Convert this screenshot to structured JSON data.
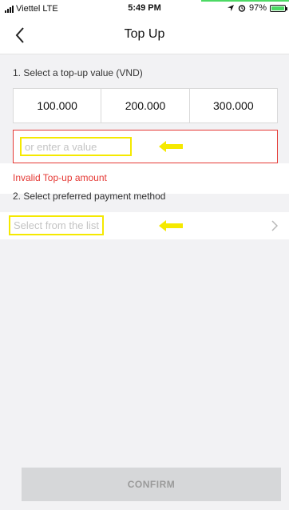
{
  "status_bar": {
    "carrier": "Viettel",
    "network": "LTE",
    "time": "5:49 PM",
    "battery": "97%",
    "battery_level": 0.97,
    "battery_color": "#4cd964"
  },
  "header": {
    "title": "Top Up",
    "back_icon": "chevron-left-icon"
  },
  "amount_section": {
    "label": "1. Select a top-up value (VND)",
    "options": [
      "100.000",
      "200.000",
      "300.000"
    ],
    "custom_placeholder": "or enter a value",
    "custom_value": "",
    "error": "Invalid Top-up amount",
    "error_color": "#e53935"
  },
  "payment_section": {
    "label": "2. Select preferred payment method",
    "placeholder": "Select from the list",
    "chevron_icon": "chevron-right-icon"
  },
  "annotations": {
    "highlight_color": "#f5e900",
    "arrow_icon": "arrow-left-icon"
  },
  "footer": {
    "confirm_label": "CONFIRM"
  }
}
